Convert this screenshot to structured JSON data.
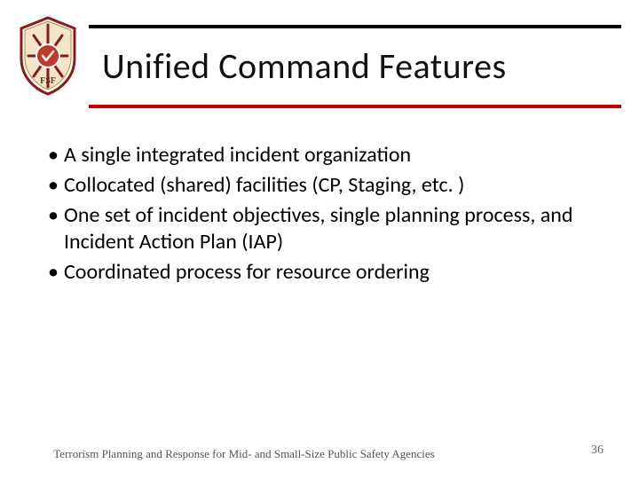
{
  "title": "Unified Command Features",
  "bullets": [
    "A single integrated incident organization",
    "Collocated (shared) facilities (CP, Staging, etc. )",
    "One set of incident objectives, single planning process, and Incident Action Plan (IAP)",
    "Coordinated process for resource ordering"
  ],
  "footer": "Terrorism Planning and Response for Mid- and Small-Size Public Safety Agencies",
  "page_number": "36",
  "logo": {
    "name": "fsf-shield-icon",
    "text_top": "FSF"
  },
  "colors": {
    "accent": "#c00000"
  }
}
